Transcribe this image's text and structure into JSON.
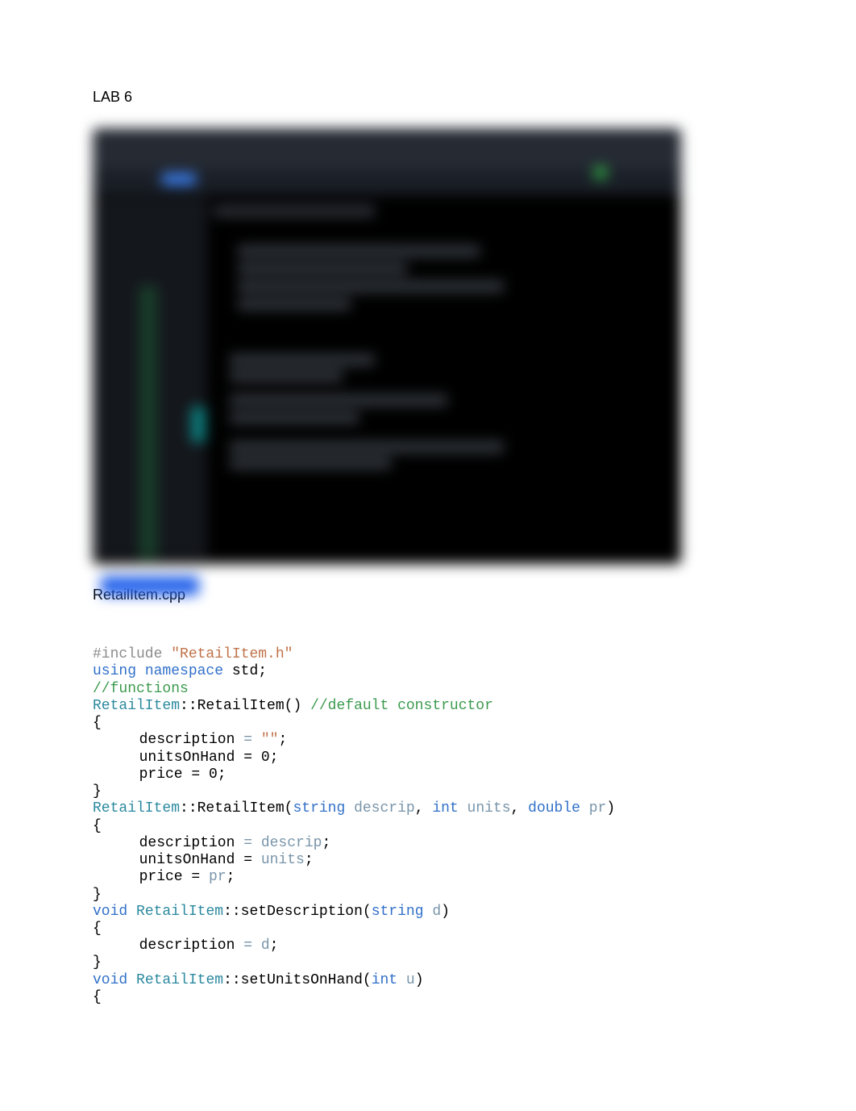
{
  "heading": "LAB 6",
  "filename": "RetailItem.cpp",
  "code": {
    "l1": {
      "include": "#include",
      "header": " \"RetailItem.h\""
    },
    "l2": {
      "using": "using",
      "namespace": " namespace",
      "std": " std;"
    },
    "l3": {
      "comment": "//functions"
    },
    "l4": {
      "class": "RetailItem",
      "rest": "::RetailItem() ",
      "comment": "//default constructor"
    },
    "l5": "{",
    "l6": {
      "pre": "description ",
      "eq": "=",
      "val": " \"\"",
      "post": ";"
    },
    "l7": {
      "text": "unitsOnHand = 0;"
    },
    "l8": {
      "text": "price = 0;"
    },
    "l9": "}",
    "l10": {
      "class": "RetailItem",
      "rest": "::RetailItem(",
      "t1": "string",
      "p1": " descrip",
      "c1": ", ",
      "t2": "int",
      "p2": " units",
      "c2": ", ",
      "t3": "double",
      "p3": " pr",
      "end": ")"
    },
    "l11": "{",
    "l12": {
      "pre": "description ",
      "eq": "=",
      "val": " descrip",
      "post": ";"
    },
    "l13": {
      "pre": "unitsOnHand = ",
      "val": "units",
      "post": ";"
    },
    "l14": {
      "pre": "price = ",
      "val": "pr",
      "post": ";"
    },
    "l15": "}",
    "l16": {
      "kw": "void",
      "sp": " ",
      "class": "RetailItem",
      "rest": "::setDescription(",
      "t1": "string",
      "p1": " d",
      "end": ")"
    },
    "l17": "{",
    "l18": {
      "pre": "description ",
      "eq": "=",
      "val": " d",
      "post": ";"
    },
    "l19": "}",
    "l20": {
      "kw": "void",
      "sp": " ",
      "class": "RetailItem",
      "rest": "::setUnitsOnHand(",
      "t1": "int",
      "p1": " u",
      "end": ")"
    },
    "l21": "{"
  }
}
